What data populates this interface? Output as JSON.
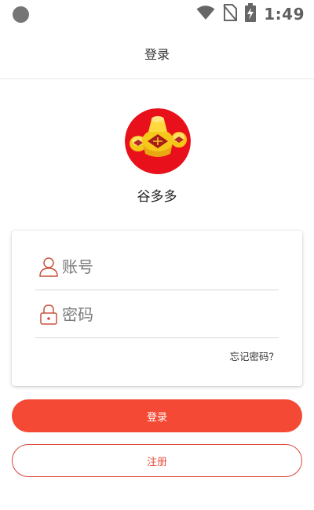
{
  "status_bar": {
    "time": "1:49",
    "icons": [
      "wifi-icon",
      "no-sim-icon",
      "battery-charging-icon"
    ]
  },
  "header": {
    "title": "登录"
  },
  "app": {
    "name": "谷多多",
    "logo_icon": "gold-ingot-logo"
  },
  "login_form": {
    "username_placeholder": "账号",
    "username_value": "",
    "password_placeholder": "密码",
    "password_value": "",
    "forgot_label": "忘记密码？"
  },
  "actions": {
    "login_label": "登录",
    "register_label": "注册"
  },
  "colors": {
    "accent": "#f44a35",
    "icon_outline": "#c8543e",
    "logo_bg": "#e8101a",
    "gold": "#f5c518"
  }
}
